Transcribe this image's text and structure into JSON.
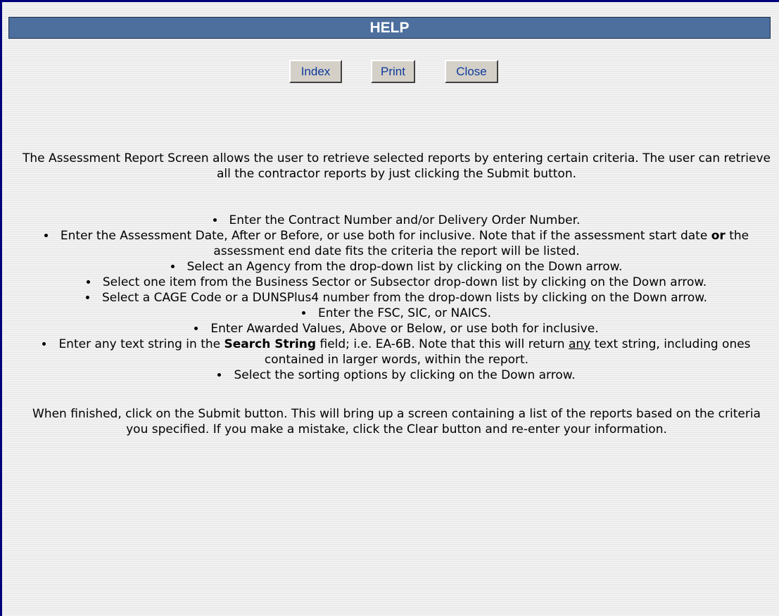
{
  "title": "HELP",
  "buttons": {
    "index": "Index",
    "print": "Print",
    "close": "Close"
  },
  "intro": "The Assessment Report Screen allows the user to retrieve selected reports by entering certain criteria. The user can retrieve all the contractor reports by just clicking the Submit button.",
  "steps": {
    "contract": "Enter the Contract Number and/or Delivery Order Number.",
    "assessment_a": "Enter the Assessment Date, After or Before, or use both for inclusive. Note that if the assessment start date",
    "assessment_bold": "or",
    "assessment_b": "the assessment end date fits the criteria the report will be listed.",
    "agency": "Select an Agency from the drop-down list by clicking on the Down arrow.",
    "sector": "Select one item from the Business Sector or Subsector drop-down list by clicking on the Down arrow.",
    "cage": "Select a CAGE Code or a DUNSPlus4 number from the drop-down lists by clicking on the Down arrow.",
    "fsc": "Enter the FSC, SIC, or NAICS.",
    "awarded": "Enter Awarded Values, Above or Below, or use both for inclusive.",
    "search_a": "Enter any text string in the",
    "search_bold": "Search String",
    "search_b": "field; i.e. EA-6B. Note that this will return",
    "search_underline": "any",
    "search_c": "text string, including ones contained in larger words, within the report.",
    "sorting": "Select the sorting options by clicking on the Down arrow."
  },
  "outro": "When finished, click on the Submit button. This will bring up a screen containing a list of the reports based on the criteria you specified. If you make a mistake, click the Clear button and re-enter your information.",
  "colors": {
    "title_bar": "#4d6f9e",
    "window_border": "#00007a",
    "button_face": "#d4d0c8",
    "button_text": "#0d3a9c"
  }
}
